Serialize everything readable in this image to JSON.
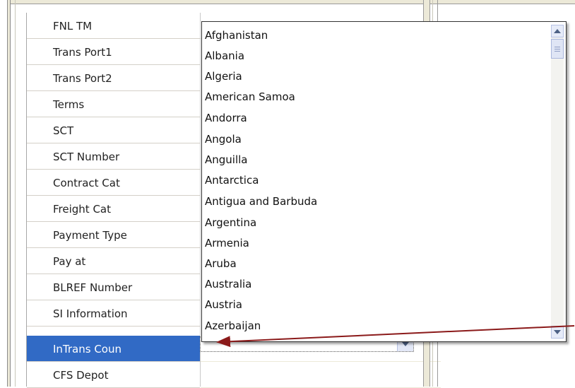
{
  "property_grid": {
    "labels": [
      "FNL TM",
      "Trans Port1",
      "Trans Port2",
      "Terms",
      "SCT",
      "SCT Number",
      "Contract Cat",
      "Freight Cat",
      "Payment Type",
      "Pay at",
      "BLREF Number",
      "SI Information",
      "InTrans Coun",
      "CFS Depot"
    ],
    "selected_label": "InTrans Coun"
  },
  "country_dropdown": {
    "value": "",
    "options": [
      "Afghanistan",
      "Albania",
      "Algeria",
      "American Samoa",
      "Andorra",
      "Angola",
      "Anguilla",
      "Antarctica",
      "Antigua and Barbuda",
      "Argentina",
      "Armenia",
      "Aruba",
      "Australia",
      "Austria",
      "Azerbaijan"
    ]
  },
  "colors": {
    "selection": "#316ac5",
    "arrow": "#8b1a1a"
  },
  "icons": {
    "combo_button": "chevron-down-icon",
    "scroll_up": "scroll-up-icon",
    "scroll_down": "scroll-down-icon",
    "annotation": "arrow-icon"
  }
}
